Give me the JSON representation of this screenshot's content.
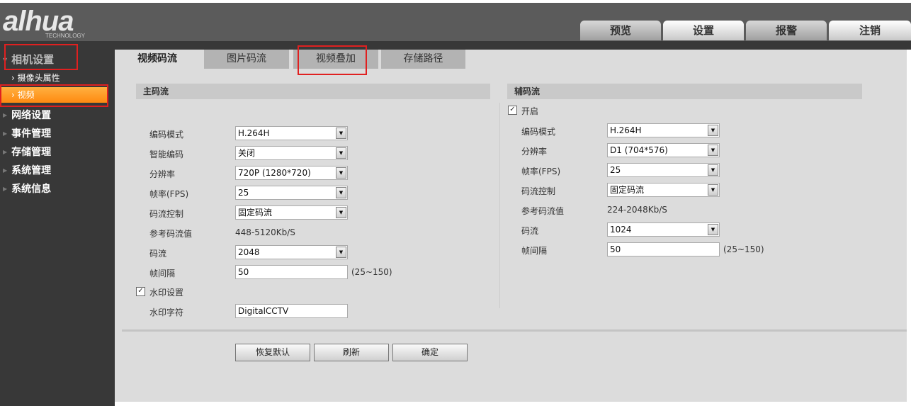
{
  "brand": {
    "logo": "alhua",
    "tagline": "TECHNOLOGY"
  },
  "nav": [
    "预览",
    "设置",
    "报警",
    "注销"
  ],
  "sidebar": {
    "camera": "相机设置",
    "camera_items": [
      "摄像头属性",
      "视频"
    ],
    "groups": [
      "网络设置",
      "事件管理",
      "存储管理",
      "系统管理",
      "系统信息"
    ]
  },
  "tabs": [
    "视频码流",
    "图片码流",
    "视频叠加",
    "存储路径"
  ],
  "main": {
    "title": "主码流",
    "rows": [
      {
        "label": "编码模式",
        "value": "H.264H",
        "type": "select"
      },
      {
        "label": "智能编码",
        "value": "关闭",
        "type": "select"
      },
      {
        "label": "分辨率",
        "value": "720P (1280*720)",
        "type": "select"
      },
      {
        "label": "帧率(FPS)",
        "value": "25",
        "type": "select"
      },
      {
        "label": "码流控制",
        "value": "固定码流",
        "type": "select"
      },
      {
        "label": "参考码流值",
        "value": "448-5120Kb/S",
        "type": "text"
      },
      {
        "label": "码流",
        "value": "2048",
        "type": "select"
      },
      {
        "label": "帧间隔",
        "value": "50",
        "type": "input",
        "hint": "(25~150)"
      }
    ],
    "watermark_label": "水印设置",
    "watermark_checked": true,
    "watermark_text_label": "水印字符",
    "watermark_text": "DigitalCCTV"
  },
  "sub": {
    "title": "辅码流",
    "enable_label": "开启",
    "enabled": true,
    "rows": [
      {
        "label": "编码模式",
        "value": "H.264H",
        "type": "select"
      },
      {
        "label": "分辨率",
        "value": "D1 (704*576)",
        "type": "select"
      },
      {
        "label": "帧率(FPS)",
        "value": "25",
        "type": "select"
      },
      {
        "label": "码流控制",
        "value": "固定码流",
        "type": "select"
      },
      {
        "label": "参考码流值",
        "value": "224-2048Kb/S",
        "type": "text"
      },
      {
        "label": "码流",
        "value": "1024",
        "type": "select"
      },
      {
        "label": "帧间隔",
        "value": "50",
        "type": "input",
        "hint": "(25~150)"
      }
    ]
  },
  "buttons": {
    "default": "恢复默认",
    "refresh": "刷新",
    "ok": "确定"
  },
  "check_mark": "✓"
}
